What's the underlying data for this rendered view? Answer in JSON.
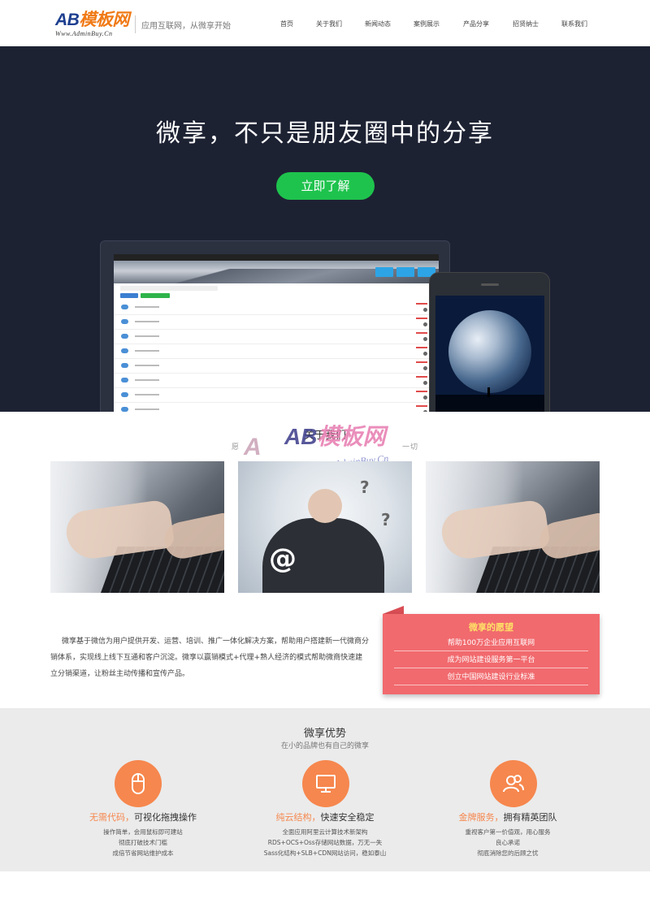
{
  "header": {
    "logo_ab": "AB",
    "logo_brand": "模板网",
    "logo_sub": "Www.AdminBuy.Cn",
    "slogan": "应用互联网，从微享开始",
    "nav": [
      "首页",
      "关于我们",
      "新闻动态",
      "案例展示",
      "产品分享",
      "招贤纳士",
      "联系我们"
    ]
  },
  "banner": {
    "title": "微享，不只是朋友圈中的分享",
    "cta_label": "立即了解",
    "slide_count": 2,
    "active_slide": 1
  },
  "watermark": {
    "ab": "AB",
    "brand": "模板网",
    "sub": "www.AdminBuy.Cn"
  },
  "about": {
    "title": "关于我们",
    "subtitle": "愿",
    "subtitle_tail": "一切",
    "paragraph": "微享基于微信为用户提供开发、运营、培训、推广一体化解决方案，帮助用户搭建新一代微商分销体系，实现线上线下互通和客户沉淀。微享以赢销模式+代理+熟人经济的模式帮助微商快速建立分销渠道，让粉丝主动传播和宣传产品。"
  },
  "wish": {
    "title": "微享的愿望",
    "items": [
      "帮助100万企业应用互联网",
      "成为网站建设服务第一平台",
      "创立中国网站建设行业标准"
    ]
  },
  "advantages": {
    "title": "微享优势",
    "subtitle": "在小的品牌也有自己的微享",
    "items": [
      {
        "icon": "mouse-icon",
        "highlight": "无需代码，",
        "rest": "可视化拖拽操作",
        "lines": [
          "操作简单，会用鼠标即可建站",
          "彻底打破技术门槛",
          "成倍节省网站维护成本"
        ]
      },
      {
        "icon": "monitor-icon",
        "highlight": "纯云结构，",
        "rest": "快速安全稳定",
        "lines": [
          "全面应用阿里云计算技术新架构",
          "RDS+OCS+Oss存储网站数据，万无一失",
          "Sass化结构+SLB+CDN网站访问，稳如泰山"
        ]
      },
      {
        "icon": "users-icon",
        "highlight": "金牌服务，",
        "rest": "拥有精英团队",
        "lines": [
          "重视客户第一价值观，用心服务",
          "良心承诺",
          "彻底消除您的后顾之忧"
        ]
      }
    ]
  },
  "colors": {
    "header_bg": "#ffffff",
    "banner_bg": "#1d2233",
    "cta_green": "#1ec34d",
    "wish_red": "#f16a6e",
    "wish_title": "#ffe067",
    "accent_orange": "#f6874e",
    "adv_bg": "#ebebeb"
  }
}
